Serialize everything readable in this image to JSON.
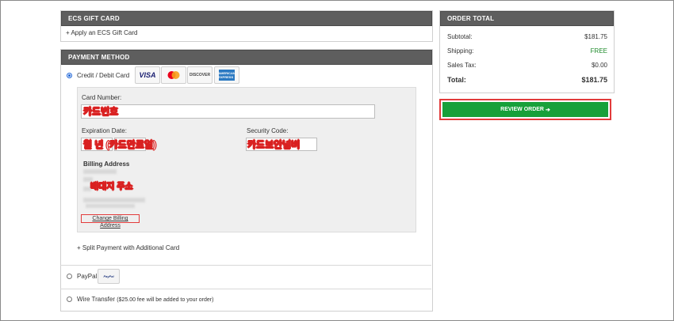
{
  "gift_card": {
    "header": "ECS GIFT CARD",
    "apply_link": "+ Apply an ECS Gift Card"
  },
  "payment": {
    "header": "PAYMENT METHOD",
    "credit_label": "Credit / Debit Card",
    "card_logos": [
      "VISA",
      "mastercard",
      "DISCOVER",
      "AMERICAN EXPRESS"
    ],
    "card_number_label": "Card Number:",
    "card_number_annotation": "카드번호",
    "expiration_label": "Expiration Date:",
    "expiration_annotation": "월 년 (카드만료일)",
    "security_label": "Security Code:",
    "security_annotation": "카드보안넘버",
    "billing_label": "Billing Address",
    "billing_annotation": "배대지 주소",
    "change_billing": "Change Billing Address",
    "split_payment": "+ Split Payment with Additional Card",
    "paypal_label": "PayPal",
    "paypal_logo": "PayPal",
    "wire_label": "Wire Transfer",
    "wire_note": "($25.00 fee will be added to your order)"
  },
  "order_total": {
    "header": "ORDER TOTAL",
    "subtotal_label": "Subtotal:",
    "subtotal_value": "$181.75",
    "shipping_label": "Shipping:",
    "shipping_value": "FREE",
    "tax_label": "Sales Tax:",
    "tax_value": "$0.00",
    "total_label": "Total:",
    "total_value": "$181.75",
    "review_button": "REVIEW ORDER",
    "review_arrow": "➔"
  },
  "colors": {
    "header_bg": "#5e5e5e",
    "review_green": "#17a03a",
    "highlight_red": "#e23b3b",
    "free_green": "#1d8a2a"
  }
}
